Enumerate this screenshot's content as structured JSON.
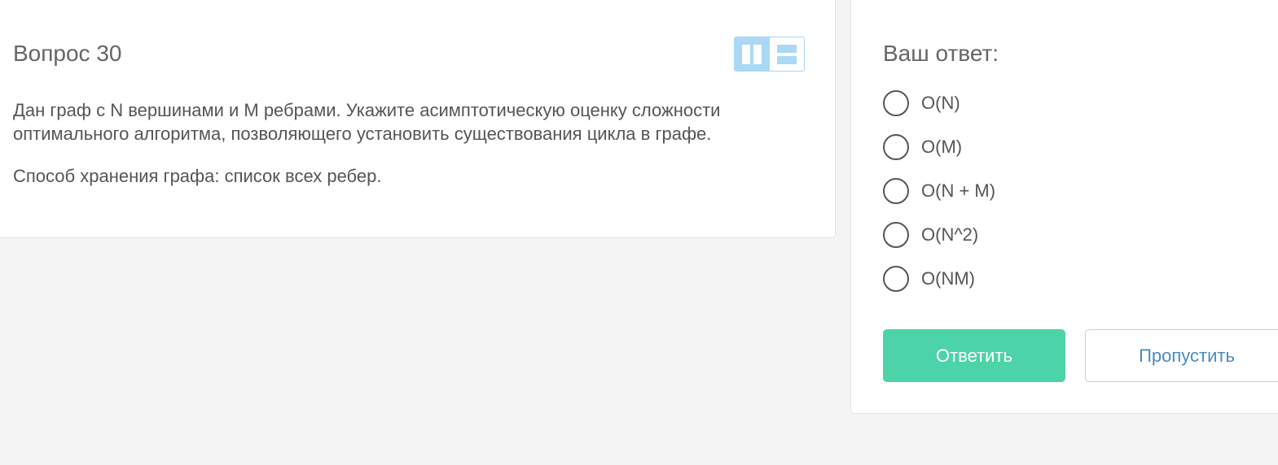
{
  "question": {
    "title": "Вопрос 30",
    "paragraphs": [
      "Дан граф с N вершинами и M ребрами. Укажите асимптотическую оценку сложности оптимального алгоритма, позволяющего установить существования цикла в графе.",
      "Способ хранения графа: список всех ребер."
    ],
    "layout_toggle": {
      "active": "two-column",
      "icons": [
        "two-column-layout-icon",
        "stacked-layout-icon"
      ]
    }
  },
  "answer": {
    "title": "Ваш ответ:",
    "options": [
      {
        "label": "O(N)"
      },
      {
        "label": "O(M)"
      },
      {
        "label": "O(N + M)"
      },
      {
        "label": "O(N^2)"
      },
      {
        "label": "O(NM)"
      }
    ],
    "submit_label": "Ответить",
    "skip_label": "Пропустить"
  },
  "colors": {
    "background": "#f4f4f4",
    "accent_green": "#4cd3a7",
    "accent_blue": "#a9d9f5",
    "link_blue": "#4a8bbf"
  }
}
